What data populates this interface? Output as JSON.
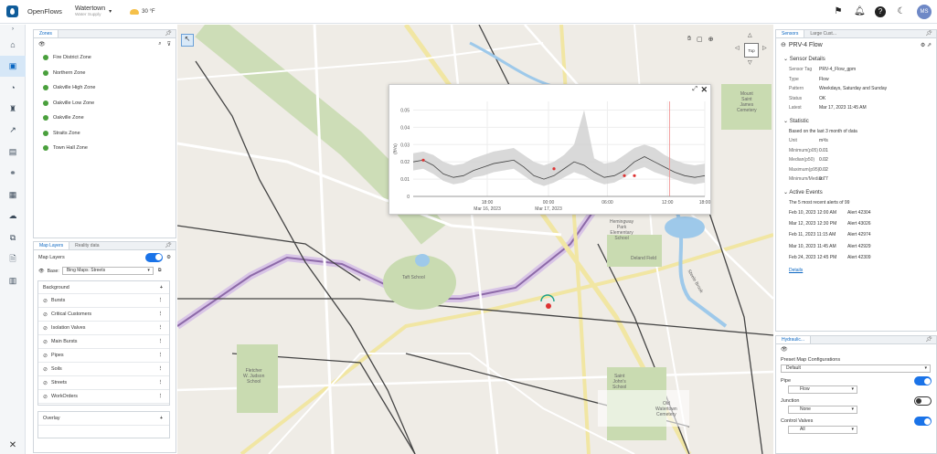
{
  "app": {
    "name": "OpenFlows",
    "location": "Watertown",
    "sublocation": "Water Supply",
    "temperature": "30 °F",
    "user_initials": "MS"
  },
  "nav": {
    "items": [
      "home",
      "map",
      "gauge",
      "hydrant",
      "trend",
      "report",
      "network",
      "grid",
      "cloud",
      "scenario",
      "alert",
      "building"
    ],
    "bottom": "tools"
  },
  "zones": {
    "tab": "Zones",
    "items": [
      "Fire District Zone",
      "Northern Zone",
      "Oakville High Zone",
      "Oakville Low Zone",
      "Oakville Zone",
      "Straits Zone",
      "Town Hall Zone"
    ]
  },
  "layers": {
    "tabs": [
      "Map Layers",
      "Reality data"
    ],
    "title": "Map Layers",
    "base_label": "Base:",
    "base_value": "Bing Maps: Streets",
    "background_label": "Background",
    "items": [
      "Bursts",
      "Critical Customers",
      "Isolation Valves",
      "Main Bursts",
      "Pipes",
      "Soils",
      "Streets",
      "WorkOrders"
    ],
    "overlay_label": "Overlay"
  },
  "map_labels": {
    "taft": "Taft School",
    "hemingway": "Hemingway\nPark\nElementary\nSchool",
    "deland": "Deland Field",
    "mount": "Mount\nSaint\nJames\nCemetery",
    "fletcher": "Fletcher\nW. Judson\nSchool",
    "saintjohn": "Saint\nJohn's\nSchool",
    "oldwater": "Old\nWatertown\nCemetery",
    "sealbrook": "Steele Brook",
    "top": "Top"
  },
  "chart_data": {
    "type": "line",
    "ylabel": "(ft³/s)",
    "yticks": [
      "0",
      "0.01",
      "0.02",
      "0.03",
      "0.04",
      "0.05"
    ],
    "xticks": [
      "18:00\nMar 16, 2023",
      "00:00\nMar 17, 2023",
      "06:00",
      "12:00",
      "18:00"
    ],
    "ylim": [
      0,
      0.055
    ],
    "series": [
      {
        "values": [
          0.02,
          0.021,
          0.018,
          0.013,
          0.011,
          0.012,
          0.015,
          0.017,
          0.019,
          0.02,
          0.021,
          0.017,
          0.012,
          0.01,
          0.012,
          0.016,
          0.02,
          0.018,
          0.014,
          0.011,
          0.012,
          0.015,
          0.02,
          0.023,
          0.02,
          0.017,
          0.014,
          0.012,
          0.011,
          0.012
        ]
      }
    ],
    "band_upper": [
      0.025,
      0.026,
      0.024,
      0.02,
      0.018,
      0.019,
      0.022,
      0.024,
      0.026,
      0.027,
      0.028,
      0.024,
      0.02,
      0.018,
      0.02,
      0.024,
      0.03,
      0.05,
      0.022,
      0.019,
      0.02,
      0.024,
      0.028,
      0.03,
      0.028,
      0.024,
      0.021,
      0.019,
      0.018,
      0.019
    ],
    "band_lower": [
      0.015,
      0.016,
      0.013,
      0.009,
      0.007,
      0.008,
      0.011,
      0.012,
      0.014,
      0.015,
      0.016,
      0.012,
      0.008,
      0.006,
      0.008,
      0.011,
      0.014,
      0.012,
      0.009,
      0.007,
      0.008,
      0.011,
      0.015,
      0.017,
      0.014,
      0.012,
      0.01,
      0.008,
      0.007,
      0.008
    ],
    "alerts": [
      [
        1,
        0.021
      ],
      [
        14,
        0.016
      ],
      [
        21,
        0.012
      ],
      [
        22,
        0.012
      ]
    ],
    "marker_x": 25.5
  },
  "sensor": {
    "tabs": [
      "Sensors",
      "Large Cust..."
    ],
    "title": "PRV-4 Flow",
    "details_label": "Sensor Details",
    "details": [
      [
        "Sensor Tag",
        "PRV-4_Flow_gpm"
      ],
      [
        "Type",
        "Flow"
      ],
      [
        "Pattern",
        "Weekdays, Saturday and Sunday"
      ],
      [
        "Status",
        "OK"
      ],
      [
        "Latest",
        "Mar 17, 2023 11:45 AM"
      ]
    ],
    "stat_label": "Statistic",
    "stat_note": "Based on the last 3 month of data",
    "stats": [
      [
        "Unit",
        "m³/s"
      ],
      [
        "Minimum(p05)",
        "0.01"
      ],
      [
        "Median(p50)",
        "0.02"
      ],
      [
        "Maximum(p95)",
        "0.02"
      ],
      [
        "Minimum/Median",
        "0.77"
      ]
    ],
    "events_label": "Active Events",
    "events_note": "The 5 most recent alerts of 99",
    "events": [
      [
        "Feb 10, 2023 12:00 AM",
        "Alert 42304"
      ],
      [
        "Mar 12, 2023 12:30 PM",
        "Alert 43026"
      ],
      [
        "Feb 11, 2023 11:15 AM",
        "Alert 42974"
      ],
      [
        "Mar 10, 2023 11:45 AM",
        "Alert 42929"
      ],
      [
        "Feb 24, 2023 12:45 PM",
        "Alert 42309"
      ]
    ],
    "details_link": "Details"
  },
  "hydraulic": {
    "tab": "Hydraulic...",
    "preset_label": "Preset Map Configurations",
    "preset_value": "Default",
    "rows": [
      {
        "label": "Pipe",
        "value": "Flow",
        "on": true
      },
      {
        "label": "Junction",
        "value": "None",
        "on": false
      },
      {
        "label": "Control Valves",
        "value": "All",
        "on": true
      }
    ]
  }
}
